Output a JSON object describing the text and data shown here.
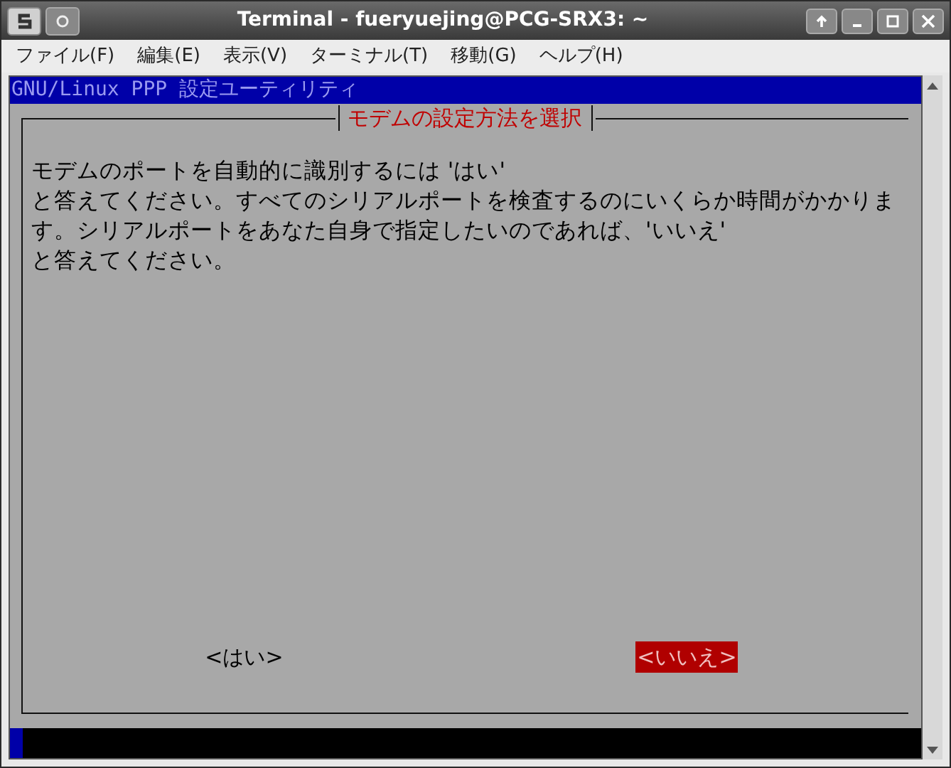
{
  "window": {
    "title": "Terminal - fueryuejing@PCG-SRX3: ~"
  },
  "menu": [
    "ファイル(F)",
    "編集(E)",
    "表示(V)",
    "ターミナル(T)",
    "移動(G)",
    "ヘルプ(H)"
  ],
  "backtitle": "GNU/Linux PPP 設定ユーティリティ",
  "dialog": {
    "title": "モデムの設定方法を選択",
    "lines": [
      "モデムのポートを自動的に識別するには 'はい'",
      "と答えてください。すべてのシリアルポートを検査するのにいくらか時間がかかりま",
      "す。シリアルポートをあなた自身で指定したいのであれば、'いいえ'",
      "と答えてください。"
    ],
    "buttons": [
      {
        "label": "<はい>",
        "selected": false
      },
      {
        "label": "<いいえ>",
        "selected": true
      }
    ]
  }
}
